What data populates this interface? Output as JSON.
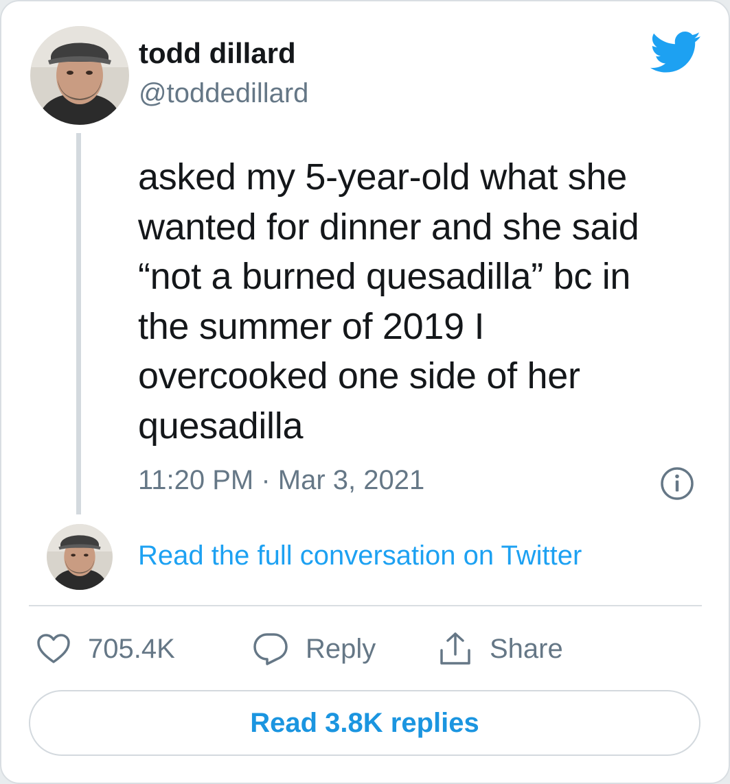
{
  "author": {
    "name": "todd dillard",
    "handle": "@toddedillard"
  },
  "tweet": {
    "text": "asked my 5-year-old what she\nwanted for dinner and she said\n“not a burned quesadilla” bc in\nthe summer of 2019 I\novercooked one side of her\nquesadilla",
    "timestamp": "11:20 PM · Mar 3, 2021"
  },
  "conversation": {
    "link_label": "Read the full conversation on Twitter"
  },
  "actions": {
    "likes_count": "705.4K",
    "reply_label": "Reply",
    "share_label": "Share"
  },
  "replies_button": {
    "label": "Read 3.8K replies"
  },
  "icons": {
    "brand": "twitter-bird-icon",
    "info": "info-icon",
    "like": "heart-icon",
    "reply": "speech-bubble-icon",
    "share": "share-arrow-icon"
  },
  "colors": {
    "brand_blue": "#1da1f2",
    "link_blue": "#1b95e0",
    "text_primary": "#14171a",
    "text_secondary": "#657786",
    "border": "#d9dee2"
  }
}
